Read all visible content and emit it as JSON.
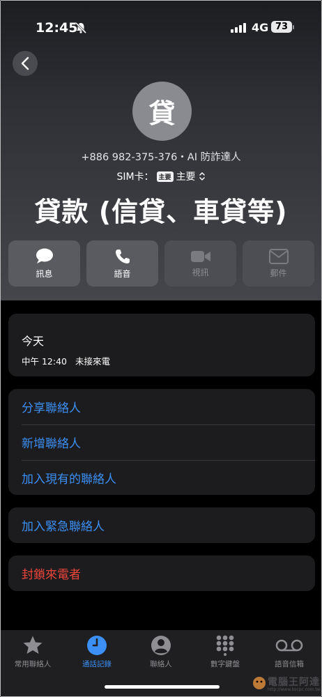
{
  "status_bar": {
    "time": "12:45",
    "network": "4G",
    "battery": "73"
  },
  "contact": {
    "avatar_initial": "貸",
    "phone_line": "+886 982-375-376・AI 防詐達人",
    "sim_prefix": "SIM卡：",
    "sim_badge": "主要",
    "sim_label": "主要",
    "name": "貸款 (信貸、車貸等)"
  },
  "actions": [
    {
      "label": "訊息",
      "icon": "message-icon",
      "enabled": true
    },
    {
      "label": "語音",
      "icon": "phone-icon",
      "enabled": true
    },
    {
      "label": "視訊",
      "icon": "video-icon",
      "enabled": false
    },
    {
      "label": "郵件",
      "icon": "mail-icon",
      "enabled": false
    }
  ],
  "recent_call": {
    "day": "今天",
    "time": "中午 12:40",
    "type": "未接來電"
  },
  "options": [
    {
      "label": "分享聯絡人"
    },
    {
      "label": "新增聯絡人"
    },
    {
      "label": "加入現有的聯絡人"
    }
  ],
  "emergency": {
    "label": "加入緊急聯絡人"
  },
  "block": {
    "label": "封鎖來電者"
  },
  "tabs": [
    {
      "label": "常用聯絡人",
      "icon": "star-icon",
      "active": false
    },
    {
      "label": "通話記錄",
      "icon": "clock-icon",
      "active": true
    },
    {
      "label": "聯絡人",
      "icon": "person-icon",
      "active": false
    },
    {
      "label": "數字鍵盤",
      "icon": "keypad-icon",
      "active": false
    },
    {
      "label": "語音信箱",
      "icon": "voicemail-icon",
      "active": false
    }
  ],
  "watermark": {
    "text": "電腦王阿達",
    "url": "http://www.kocpc.com.tw"
  },
  "colors": {
    "accent": "#3b8ff5",
    "destructive": "#f0453a",
    "card": "#1c1c1e"
  }
}
